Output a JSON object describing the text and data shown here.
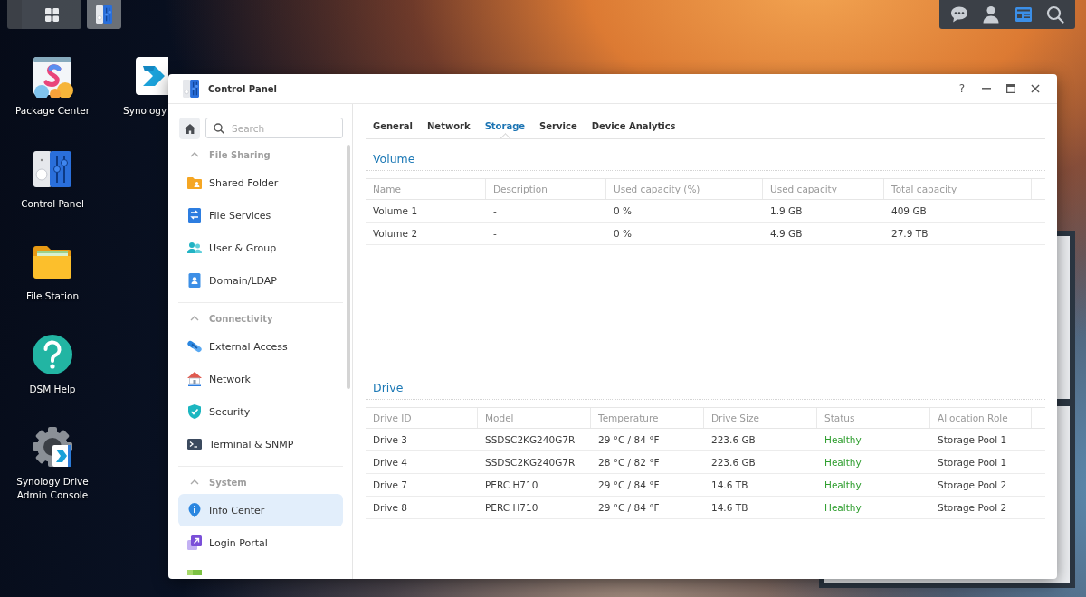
{
  "taskbar": {
    "items": [
      {
        "kind": "main-menu",
        "selected": false
      },
      {
        "kind": "control-panel",
        "selected": true
      }
    ]
  },
  "tray": {
    "items": [
      {
        "kind": "chat",
        "selected": false
      },
      {
        "kind": "user",
        "selected": false
      },
      {
        "kind": "widgets",
        "selected": true
      },
      {
        "kind": "search",
        "selected": false
      }
    ]
  },
  "desktop_icons": [
    {
      "label": "Package Center",
      "kind": "package-center"
    },
    {
      "label": "Control Panel",
      "kind": "control-panel"
    },
    {
      "label": "File Station",
      "kind": "file-station"
    },
    {
      "label": "DSM Help",
      "kind": "help"
    },
    {
      "label": "Synology Drive Admin Console",
      "kind": "drive-admin"
    },
    {
      "label": "Synology",
      "kind": "drive"
    }
  ],
  "window": {
    "title": "Control Panel",
    "controls": [
      {
        "kind": "help",
        "label": "?"
      },
      {
        "kind": "minimize"
      },
      {
        "kind": "maximize"
      },
      {
        "kind": "close"
      }
    ]
  },
  "sidebar": {
    "search": {
      "placeholder": "Search"
    },
    "sections": [
      {
        "title": "File Sharing",
        "expanded": true,
        "items": [
          {
            "label": "Shared Folder",
            "kind": "shared-folder",
            "selected": false
          },
          {
            "label": "File Services",
            "kind": "file-services",
            "selected": false
          },
          {
            "label": "User & Group",
            "kind": "user-group",
            "selected": false
          },
          {
            "label": "Domain/LDAP",
            "kind": "domain",
            "selected": false
          }
        ]
      },
      {
        "title": "Connectivity",
        "expanded": true,
        "items": [
          {
            "label": "External Access",
            "kind": "external-access",
            "selected": false
          },
          {
            "label": "Network",
            "kind": "network",
            "selected": false
          },
          {
            "label": "Security",
            "kind": "security",
            "selected": false
          },
          {
            "label": "Terminal & SNMP",
            "kind": "terminal",
            "selected": false
          }
        ]
      },
      {
        "title": "System",
        "expanded": true,
        "items": [
          {
            "label": "Info Center",
            "kind": "info",
            "selected": true
          },
          {
            "label": "Login Portal",
            "kind": "login-portal",
            "selected": false
          },
          {
            "kind": "partial"
          }
        ]
      }
    ]
  },
  "tabs": [
    {
      "label": "General",
      "selected": false
    },
    {
      "label": "Network",
      "selected": false
    },
    {
      "label": "Storage",
      "selected": true
    },
    {
      "label": "Service",
      "selected": false
    },
    {
      "label": "Device Analytics",
      "selected": false
    }
  ],
  "volume": {
    "title": "Volume",
    "columns": [
      "Name",
      "Description",
      "Used capacity (%)",
      "Used capacity",
      "Total capacity"
    ],
    "rows": [
      [
        "Volume 1",
        "-",
        "0 %",
        "1.9 GB",
        "409 GB"
      ],
      [
        "Volume 2",
        "-",
        "0 %",
        "4.9 GB",
        "27.9 TB"
      ]
    ]
  },
  "drive": {
    "title": "Drive",
    "columns": [
      "Drive ID",
      "Model",
      "Temperature",
      "Drive Size",
      "Status",
      "Allocation Role"
    ],
    "rows": [
      {
        "drive_id": "Drive 3",
        "model": "SSDSC2KG240G7R",
        "temperature": "29 °C / 84 °F",
        "drive_size": "223.6 GB",
        "status": "Healthy",
        "healthy": true,
        "allocation_role": "Storage Pool 1"
      },
      {
        "drive_id": "Drive 4",
        "model": "SSDSC2KG240G7R",
        "temperature": "28 °C / 82 °F",
        "drive_size": "223.6 GB",
        "status": "Healthy",
        "healthy": true,
        "allocation_role": "Storage Pool 1"
      },
      {
        "drive_id": "Drive 7",
        "model": "PERC H710",
        "temperature": "29 °C / 84 °F",
        "drive_size": "14.6 TB",
        "status": "Healthy",
        "healthy": true,
        "allocation_role": "Storage Pool 2"
      },
      {
        "drive_id": "Drive 8",
        "model": "PERC H710",
        "temperature": "29 °C / 84 °F",
        "drive_size": "14.6 TB",
        "status": "Healthy",
        "healthy": true,
        "allocation_role": "Storage Pool 2"
      }
    ]
  }
}
